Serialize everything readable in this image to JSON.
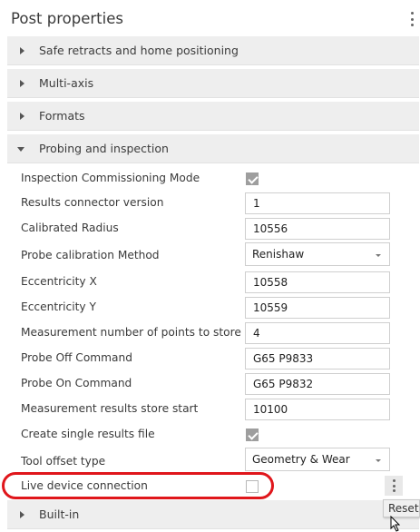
{
  "panel": {
    "title": "Post properties"
  },
  "sections": {
    "safe_retracts": "Safe retracts and home positioning",
    "multi_axis": "Multi-axis",
    "formats": "Formats",
    "probing": "Probing and inspection",
    "built_in": "Built-in"
  },
  "properties": {
    "inspection_commissioning_mode": {
      "label": "Inspection Commissioning Mode",
      "checked": true
    },
    "results_connector_version": {
      "label": "Results connector version",
      "value": "1"
    },
    "calibrated_radius": {
      "label": "Calibrated Radius",
      "value": "10556"
    },
    "probe_calibration_method": {
      "label": "Probe calibration Method",
      "value": "Renishaw"
    },
    "eccentricity_x": {
      "label": "Eccentricity X",
      "value": "10558"
    },
    "eccentricity_y": {
      "label": "Eccentricity Y",
      "value": "10559"
    },
    "measurement_points": {
      "label": "Measurement number of points to store",
      "value": "4"
    },
    "probe_off_command": {
      "label": "Probe Off Command",
      "value": "G65 P9833"
    },
    "probe_on_command": {
      "label": "Probe On Command",
      "value": "G65 P9832"
    },
    "measurement_store_start": {
      "label": "Measurement results store start",
      "value": "10100"
    },
    "create_single_results_file": {
      "label": "Create single results file",
      "checked": true
    },
    "tool_offset_type": {
      "label": "Tool offset type",
      "value": "Geometry & Wear"
    },
    "live_device_connection": {
      "label": "Live device connection",
      "checked": false
    }
  },
  "tooltip": {
    "text": "Reset"
  },
  "colors": {
    "highlight": "#e0161b",
    "section_bg": "#eeeeee",
    "checkbox_checked": "#9e9e9e"
  }
}
